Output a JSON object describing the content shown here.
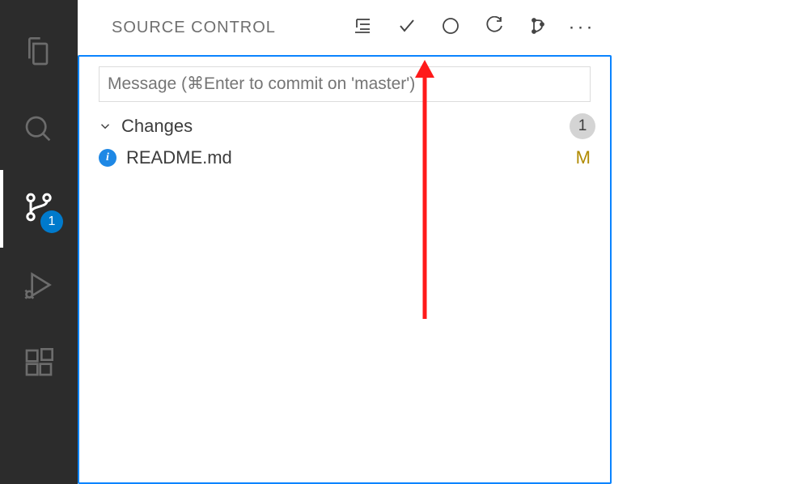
{
  "activity_bar": {
    "items": [
      {
        "name": "explorer",
        "active": false
      },
      {
        "name": "search",
        "active": false
      },
      {
        "name": "source-control",
        "active": true,
        "badge": "1"
      },
      {
        "name": "run-debug",
        "active": false
      },
      {
        "name": "extensions",
        "active": false
      }
    ]
  },
  "panel": {
    "title": "SOURCE CONTROL",
    "actions": {
      "view_as_tree": "view-tree",
      "commit": "check",
      "circle": "circle",
      "refresh": "refresh",
      "graph": "graph",
      "more": "···"
    },
    "message_input": {
      "value": "",
      "placeholder": "Message (⌘Enter to commit on 'master')"
    },
    "changes": {
      "label": "Changes",
      "count": "1",
      "files": [
        {
          "icon_letter": "i",
          "name": "README.md",
          "status": "M"
        }
      ]
    }
  }
}
